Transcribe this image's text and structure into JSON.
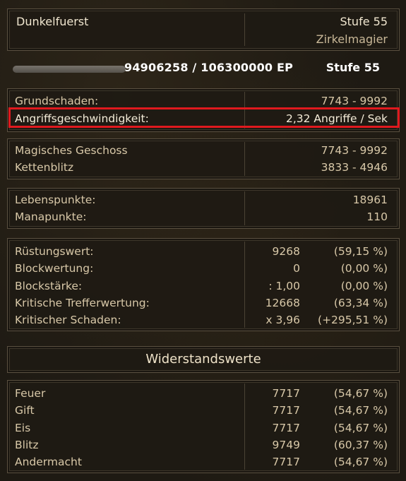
{
  "character": {
    "name": "Dunkelfuerst",
    "level": "Stufe 55",
    "class": "Zirkelmagier"
  },
  "experience": {
    "text": "94906258  /  106300000  EP",
    "level": "Stufe  55"
  },
  "damage": [
    {
      "label": "Grundschaden:",
      "value": "7743  -  9992"
    },
    {
      "label": "Angriffsgeschwindigkeit:",
      "value": "2,32  Angriffe  /  Sek"
    }
  ],
  "skills": [
    {
      "label": "Magisches  Geschoss",
      "value": "7743  -  9992"
    },
    {
      "label": "Kettenblitz",
      "value": "3833  -  4946"
    }
  ],
  "vitals": [
    {
      "label": "Lebenspunkte:",
      "value": "18961"
    },
    {
      "label": "Manapunkte:",
      "value": "110"
    }
  ],
  "defense": [
    {
      "label": "Rüstungswert:",
      "value": "9268",
      "pct": "(59,15  %)"
    },
    {
      "label": "Blockwertung:",
      "value": "0",
      "pct": "(0,00  %)"
    },
    {
      "label": "Blockstärke:",
      "value": ":  1,00",
      "pct": "(0,00  %)"
    },
    {
      "label": "Kritische  Trefferwertung:",
      "value": "12668",
      "pct": "(63,34  %)"
    },
    {
      "label": "Kritischer  Schaden:",
      "value": "x  3,96",
      "pct": "(+295,51  %)"
    }
  ],
  "resistances_title": "Widerstandswerte",
  "resistances": [
    {
      "label": "Feuer",
      "value": "7717",
      "pct": "(54,67  %)"
    },
    {
      "label": "Gift",
      "value": "7717",
      "pct": "(54,67  %)"
    },
    {
      "label": "Eis",
      "value": "7717",
      "pct": "(54,67  %)"
    },
    {
      "label": "Blitz",
      "value": "9749",
      "pct": "(60,37  %)"
    },
    {
      "label": "Andermacht",
      "value": "7717",
      "pct": "(54,67  %)"
    }
  ],
  "colors": {
    "highlight": "#e0191e",
    "label": "#d8c8a8",
    "value": "#e8d3a3"
  }
}
